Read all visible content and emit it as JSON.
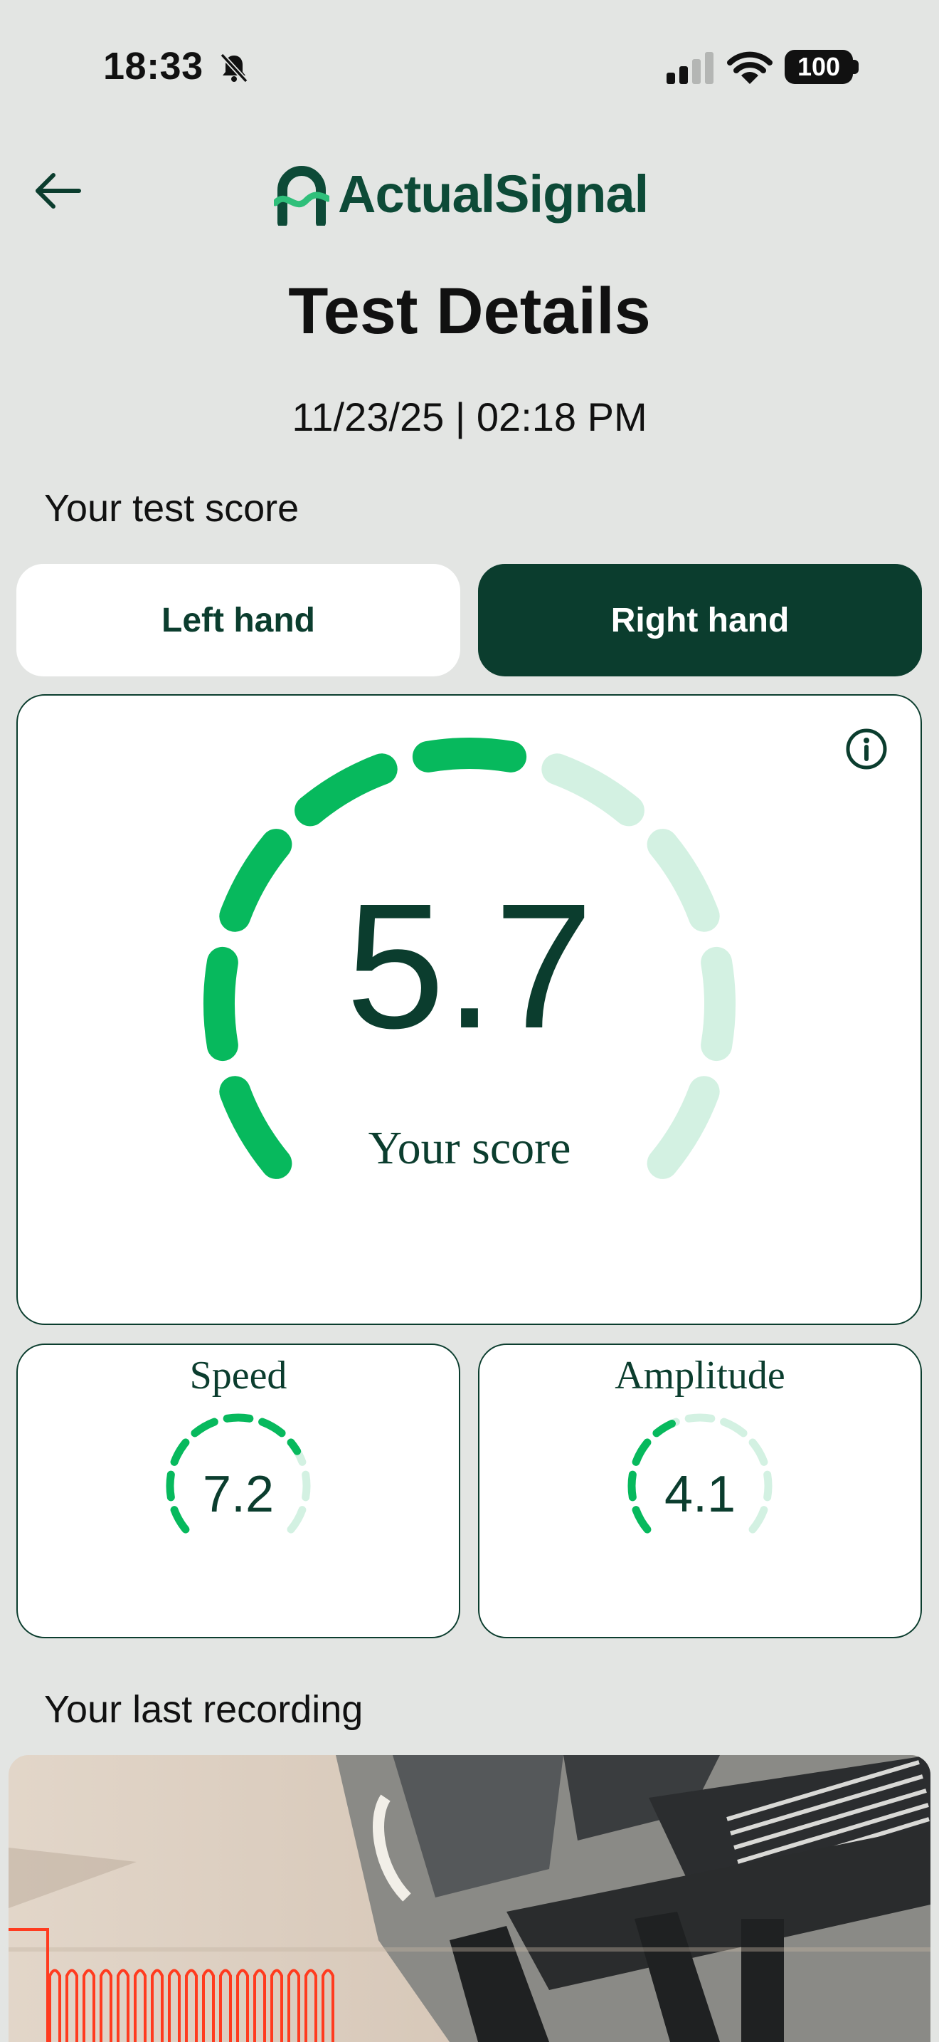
{
  "status_bar": {
    "time": "18:33",
    "battery": "100"
  },
  "header": {
    "logo_text": "ActualSignal"
  },
  "page": {
    "title": "Test Details",
    "datetime": "11/23/25 | 02:18 PM",
    "score_label": "Your test score",
    "recording_label": "Your last recording"
  },
  "hands": {
    "left": "Left hand",
    "right": "Right hand",
    "selected": "Right hand"
  },
  "score": {
    "value": "5.7",
    "caption": "Your score"
  },
  "metrics": [
    {
      "label": "Speed",
      "value": "7.2"
    },
    {
      "label": "Amplitude",
      "value": "4.1"
    }
  ],
  "colors": {
    "brand_dark": "#0b3d2e",
    "gauge_active": "#07b95d",
    "gauge_inactive": "#d3f1e2",
    "recording_trace": "#ff3b1f"
  }
}
